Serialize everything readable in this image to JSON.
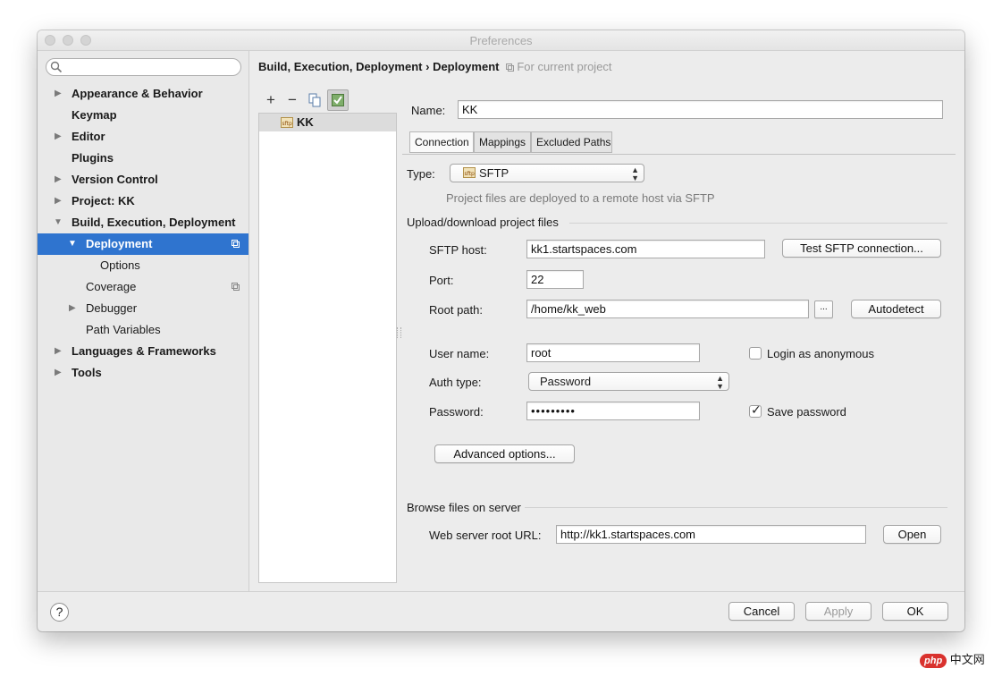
{
  "window": {
    "title": "Preferences"
  },
  "sidebar": {
    "search": {
      "placeholder": "",
      "value": ""
    },
    "items": [
      {
        "label": "Appearance & Behavior",
        "expandable": true
      },
      {
        "label": "Keymap",
        "expandable": false
      },
      {
        "label": "Editor",
        "expandable": true
      },
      {
        "label": "Plugins",
        "expandable": false
      },
      {
        "label": "Version Control",
        "expandable": true
      },
      {
        "label": "Project: KK",
        "expandable": true
      },
      {
        "label": "Build, Execution, Deployment",
        "expandable": true,
        "expanded": true
      },
      {
        "label": "Deployment",
        "expanded": true,
        "selected": true
      },
      {
        "label": "Options"
      },
      {
        "label": "Coverage"
      },
      {
        "label": "Debugger",
        "expandable": true
      },
      {
        "label": "Path Variables"
      },
      {
        "label": "Languages & Frameworks",
        "expandable": true
      },
      {
        "label": "Tools",
        "expandable": true
      }
    ]
  },
  "breadcrumb": {
    "parent": "Build, Execution, Deployment",
    "separator": "›",
    "current": "Deployment",
    "scope": "For current project"
  },
  "toolbar": {
    "add": "+",
    "remove": "−"
  },
  "servers": [
    {
      "name": "KK"
    }
  ],
  "form": {
    "name_label": "Name:",
    "name_value": "KK",
    "tabs": [
      {
        "label": "Connection",
        "active": true
      },
      {
        "label": "Mappings"
      },
      {
        "label": "Excluded Paths"
      }
    ],
    "type_label": "Type:",
    "type_value": "SFTP",
    "type_description": "Project files are deployed to a remote host via SFTP",
    "upload_section": "Upload/download project files",
    "host_label": "SFTP host:",
    "host_value": "kk1.startspaces.com",
    "test_button": "Test SFTP connection...",
    "port_label": "Port:",
    "port_value": "22",
    "root_label": "Root path:",
    "root_value": "/home/kk_web",
    "browse_button": "...",
    "autodetect_button": "Autodetect",
    "user_label": "User name:",
    "user_value": "root",
    "anonymous_label": "Login as anonymous",
    "anonymous_checked": false,
    "auth_label": "Auth type:",
    "auth_value": "Password",
    "password_label": "Password:",
    "password_value": "•••••••••",
    "save_password_label": "Save password",
    "save_password_checked": true,
    "advanced_button": "Advanced options...",
    "browse_section": "Browse files on server",
    "web_root_label": "Web server root URL:",
    "web_root_value": "http://kk1.startspaces.com",
    "open_button": "Open"
  },
  "footer": {
    "help": "?",
    "cancel": "Cancel",
    "apply": "Apply",
    "ok": "OK"
  },
  "watermark": {
    "badge": "php",
    "text": "中文网"
  },
  "colors": {
    "selection": "#2f74cf",
    "window_bg": "#ececec"
  }
}
